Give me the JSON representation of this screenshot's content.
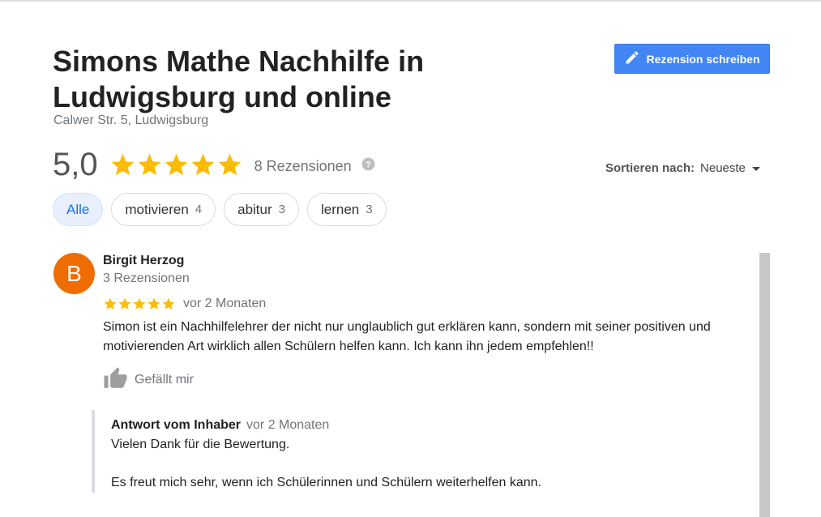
{
  "business": {
    "title": "Simons Mathe Nachhilfe in Ludwigsburg und online",
    "address": "Calwer Str. 5, Ludwigsburg"
  },
  "write_review": {
    "label": "Rezension schreiben",
    "icon": "pencil-icon"
  },
  "rating": {
    "value_text": "5,0",
    "stars": 5,
    "reviews_text": "8 Rezensionen",
    "star_color": "#fbbc04"
  },
  "sort": {
    "label": "Sortieren nach:",
    "value": "Neueste"
  },
  "filters": [
    {
      "label": "Alle",
      "count": "",
      "active": true
    },
    {
      "label": "motivieren",
      "count": "4",
      "active": false
    },
    {
      "label": "abitur",
      "count": "3",
      "active": false
    },
    {
      "label": "lernen",
      "count": "3",
      "active": false
    }
  ],
  "review": {
    "avatar_letter": "B",
    "avatar_color": "#ef6c00",
    "name": "Birgit Herzog",
    "meta": "3 Rezensionen",
    "stars": 5,
    "time": "vor 2 Monaten",
    "text": "Simon ist ein Nachhilfelehrer der nicht nur unglaublich gut erklären kann, sondern mit seiner positiven und motivierenden Art wirklich allen Schülern helfen kann. Ich kann ihn jedem empfehlen!!",
    "like_label": "Gefällt mir",
    "owner_reply": {
      "title": "Antwort vom Inhaber",
      "time": "vor 2 Monaten",
      "line1": "Vielen Dank für die Bewertung.",
      "line2": "Es freut mich sehr, wenn ich Schülerinnen und Schülern weiterhelfen kann."
    }
  }
}
